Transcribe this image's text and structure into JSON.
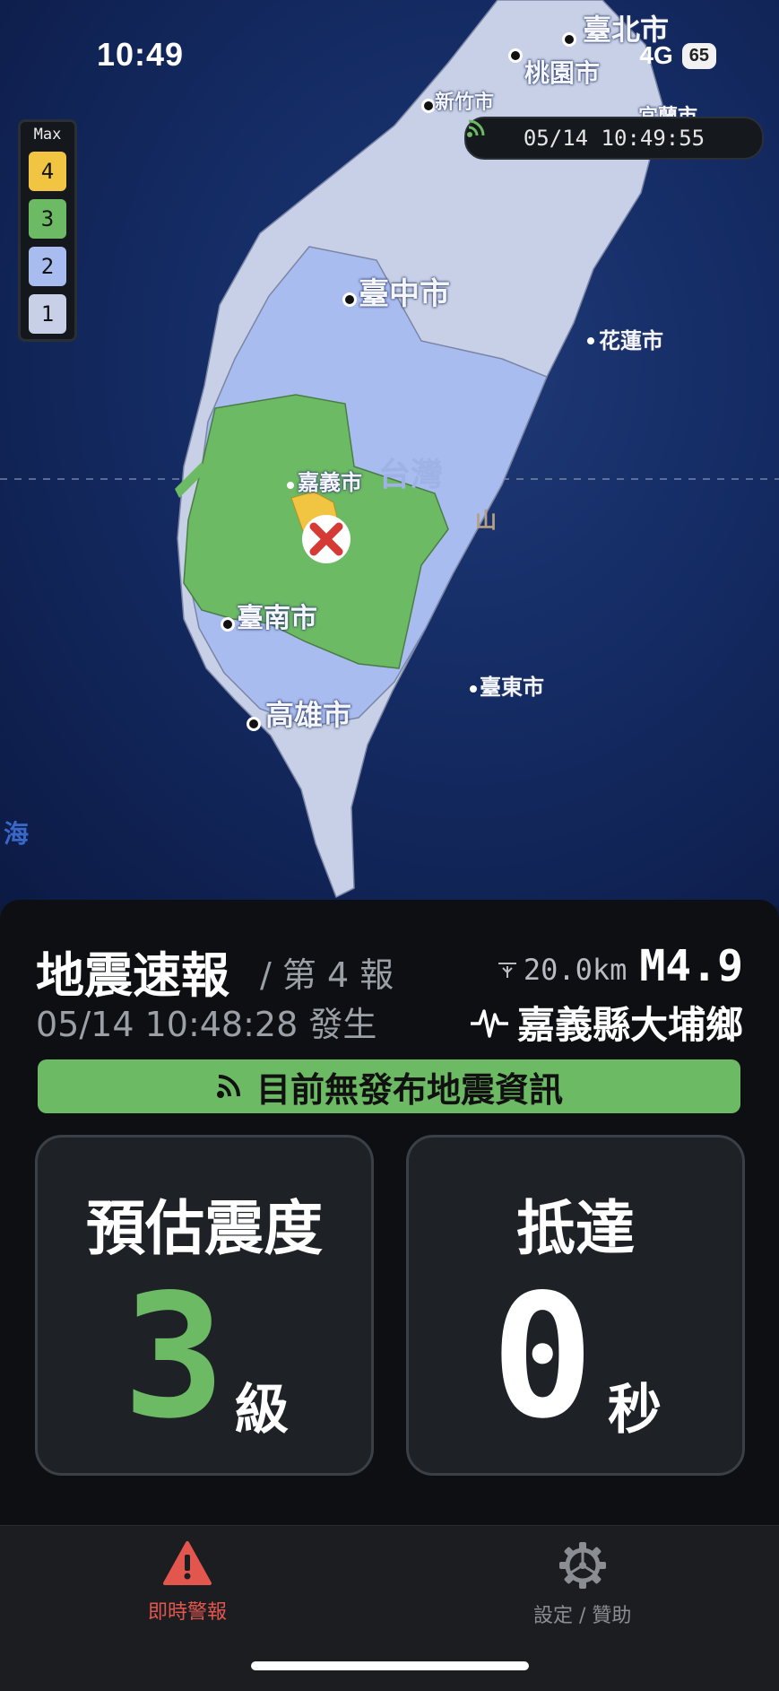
{
  "status_bar": {
    "time": "10:49",
    "network": "4G",
    "battery": "65"
  },
  "map": {
    "timestamp": "05/14 10:49:55",
    "legend": {
      "title": "Max",
      "items": [
        {
          "level": "4",
          "color": "#f1c542"
        },
        {
          "level": "3",
          "color": "#6cba63"
        },
        {
          "level": "2",
          "color": "#a9bcf0"
        },
        {
          "level": "1",
          "color": "#c7d0e6"
        }
      ]
    },
    "cities": [
      {
        "name": "臺北市",
        "key": "taipei"
      },
      {
        "name": "桃園市",
        "key": "taoyuan"
      },
      {
        "name": "新竹市",
        "key": "hsinchu"
      },
      {
        "name": "宜蘭市",
        "key": "yilan"
      },
      {
        "name": "臺中市",
        "key": "taichung"
      },
      {
        "name": "花蓮市",
        "key": "hualien"
      },
      {
        "name": "嘉義市",
        "key": "chiayi"
      },
      {
        "name": "臺南市",
        "key": "tainan"
      },
      {
        "name": "高雄市",
        "key": "kaohsiung"
      },
      {
        "name": "臺東市",
        "key": "taitung"
      }
    ],
    "map_labels": {
      "taiwan": "台灣",
      "mountains": "山",
      "sea": "海"
    }
  },
  "report": {
    "title": "地震速報",
    "report_number": "/ 第 4 報",
    "occurred": "05/14 10:48:28 發生",
    "depth": "20.0km",
    "magnitude": "M4.9",
    "location": "嘉義縣大埔鄉",
    "banner": "目前無發布地震資訊",
    "banner_color": "#6cba63"
  },
  "cards": {
    "intensity": {
      "title": "預估震度",
      "value": "3",
      "unit": "級",
      "color": "#6cba63"
    },
    "arrival": {
      "title": "抵達",
      "value": "0",
      "unit": "秒"
    }
  },
  "tabs": [
    {
      "label": "即時警報",
      "icon": "warning-icon",
      "color": "#e2564e"
    },
    {
      "label": "設定 / 贊助",
      "icon": "gear-icon",
      "color": "#8a8d92"
    }
  ]
}
